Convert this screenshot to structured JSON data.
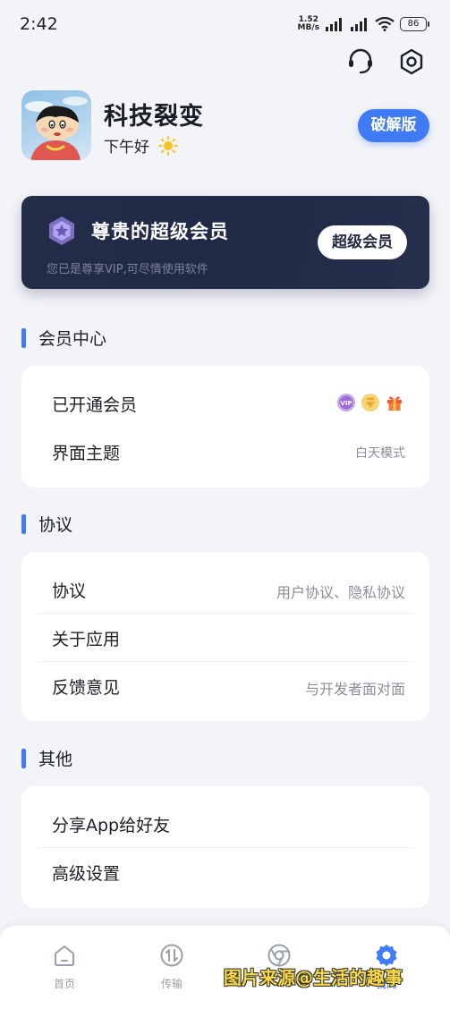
{
  "status_bar": {
    "time": "2:42",
    "net_speed_value": "1.52",
    "net_speed_unit": "MB/s",
    "battery": "86"
  },
  "profile": {
    "username": "科技裂变",
    "greeting": "下午好",
    "crack_button": "破解版"
  },
  "vip_card": {
    "title": "尊贵的超级会员",
    "subtitle": "您已是尊享VIP,可尽情使用软件",
    "button": "超级会员"
  },
  "sections": {
    "member": {
      "title": "会员中心",
      "rows": [
        {
          "label": "已开通会员",
          "value": ""
        },
        {
          "label": "界面主题",
          "value": "白天模式"
        }
      ]
    },
    "protocol": {
      "title": "协议",
      "rows": [
        {
          "label": "协议",
          "value": "用户协议、隐私协议"
        },
        {
          "label": "关于应用",
          "value": ""
        },
        {
          "label": "反馈意见",
          "value": "与开发者面对面"
        }
      ]
    },
    "other": {
      "title": "其他",
      "rows": [
        {
          "label": "分享App给好友"
        },
        {
          "label": "高级设置"
        }
      ]
    }
  },
  "bottom_nav": [
    {
      "label": "首页",
      "icon": "home-icon",
      "active": false
    },
    {
      "label": "传输",
      "icon": "transfer-icon",
      "active": false
    },
    {
      "label": "",
      "icon": "browser-icon",
      "active": false
    },
    {
      "label": "我的",
      "icon": "gear-icon",
      "active": true
    }
  ],
  "watermark": "图片来源@生活的趣事",
  "colors": {
    "accent": "#3e7bf5",
    "vip_card_bg": "#232c48",
    "background": "#f3f4f8"
  }
}
